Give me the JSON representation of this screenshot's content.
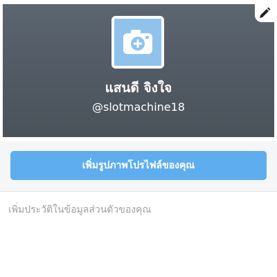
{
  "profile": {
    "display_name": "แสนดี จิงใจ",
    "username": "@slotmachine18",
    "add_photo_label": "เพิ่มรูปภาพโปรไฟล์ของคุณ",
    "bio_placeholder": "เพิ่มประวัติในข้อมูลส่วนตัวของคุณ"
  },
  "icons": {
    "edit": "pencil-icon",
    "avatar": "camera-plus-icon"
  },
  "colors": {
    "header_bg": "#535c66",
    "avatar_bg": "#90c3ec",
    "button_bg": "#5eadee",
    "placeholder_text": "#9b9fa4"
  }
}
